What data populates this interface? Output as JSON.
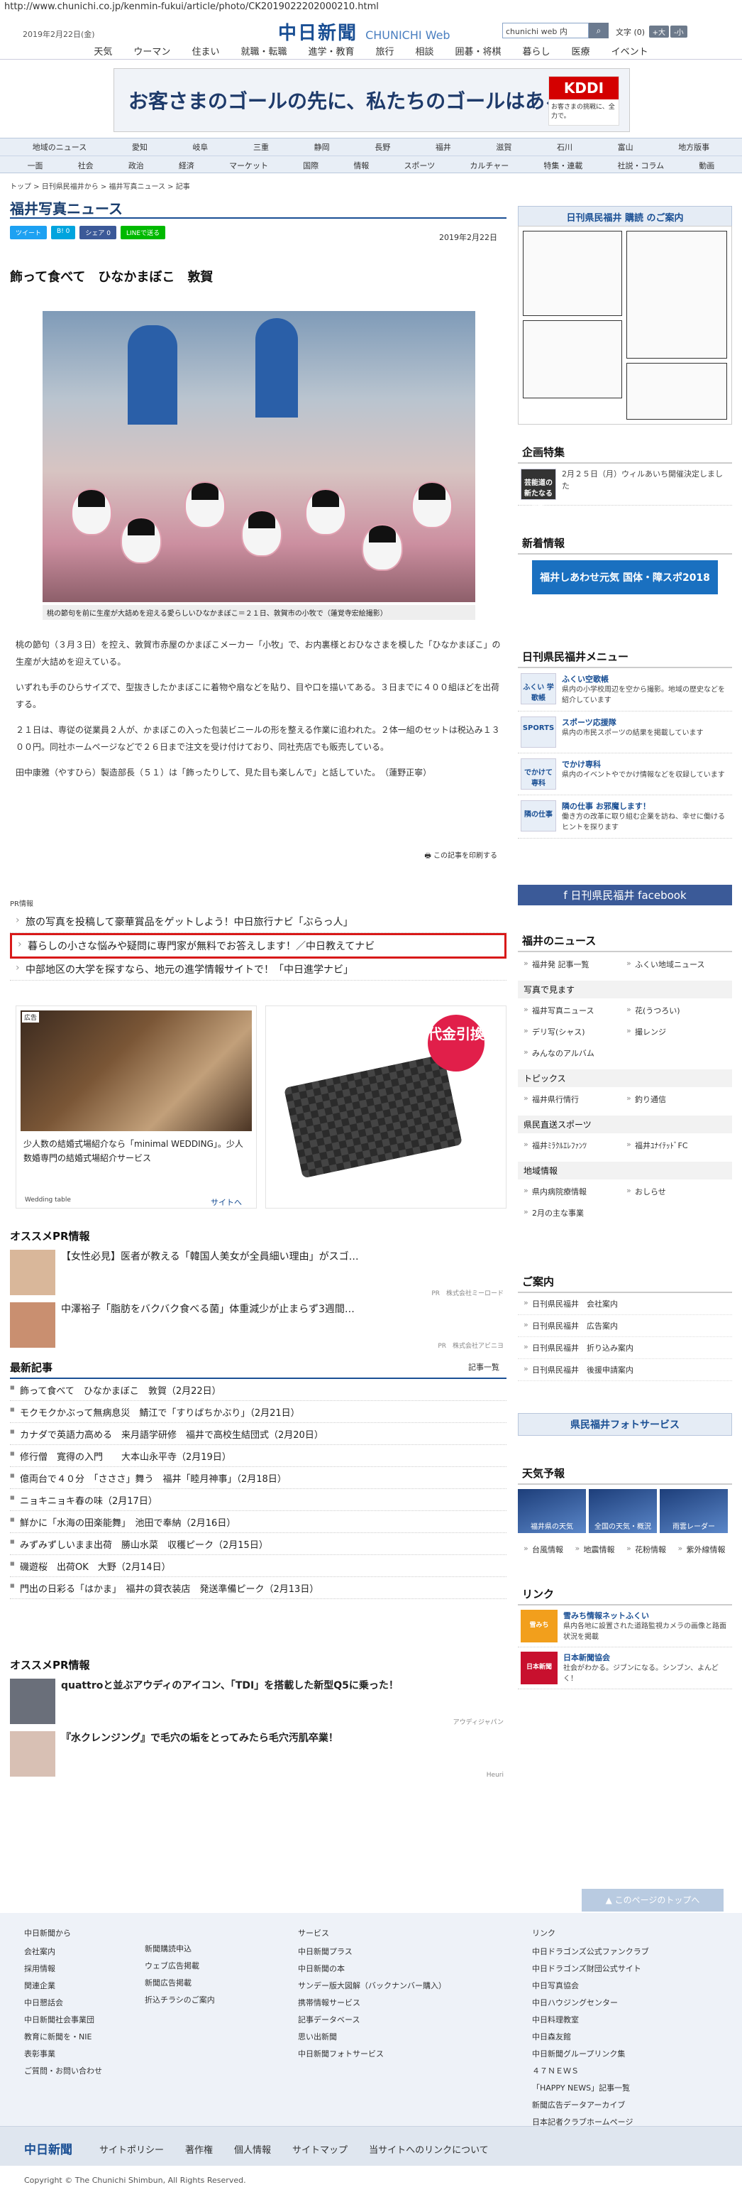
{
  "browser_url": "http://www.chunichi.co.jp/kenmin-fukui/article/photo/CK2019022202000210.html",
  "header": {
    "date": "2019年2月22日(金)",
    "logo_main": "中日新聞",
    "logo_sub": "CHUNICHI Web",
    "search_placeholder": "chunichi web 内",
    "search_icon": "search-icon",
    "fontsize_label": "文字 (0)",
    "fontsize_plus": "+大",
    "fontsize_minus": "-小"
  },
  "main_nav": [
    "天気",
    "ウーマン",
    "住まい",
    "就職・転職",
    "進学・教育",
    "旅行",
    "相談",
    "囲碁・将棋",
    "暮らし",
    "医療",
    "イベント"
  ],
  "ad_banner": {
    "text": "お客さまのゴールの先に、私たちのゴールはある。",
    "brand": "KDDI",
    "brand_sub": "お客さまの挑戦に、全力で。"
  },
  "sub_nav": {
    "row1": [
      "地域のニュース",
      "愛知",
      "岐阜",
      "三重",
      "静岡",
      "長野",
      "福井",
      "滋賀",
      "石川",
      "富山",
      "地方版事"
    ],
    "row2": [
      "一面",
      "社会",
      "政治",
      "経済",
      "マーケット",
      "国際",
      "情報",
      "スポーツ",
      "カルチャー",
      "特集・連載",
      "社説・コラム",
      "動画"
    ]
  },
  "breadcrumb": "トップ > 日刊県民福井から > 福井写真ニュース > 記事",
  "page_title": "福井写真ニュース",
  "social": {
    "tweet": "ツイート",
    "hatena": "B! 0",
    "share": "シェア 0",
    "line": "LINEで送る"
  },
  "article": {
    "date": "2019年2月22日",
    "headline": "飾って食べて　ひなかまぼこ　敦賀",
    "photo_caption": "桃の節句を前に生産が大詰めを迎える愛らしいひなかまぼこ＝２１日、敦賀市の小牧で（蓮覚寺宏絵撮影）",
    "paragraphs": [
      "桃の節句（３月３日）を控え、敦賀市赤屋のかまぼこメーカー「小牧」で、お内裏様とおひなさまを模した「ひなかまぼこ」の生産が大詰めを迎えている。",
      "いずれも手のひらサイズで、型抜きしたかまぼこに着物や扇などを貼り、目や口を描いてある。３日までに４００組ほどを出荷する。",
      "２１日は、専従の従業員２人が、かまぼこの入った包装ビニールの形を整える作業に追われた。２体一組のセットは税込み１３００円。同社ホームページなどで２６日まで注文を受け付けており、同社売店でも販売している。",
      "田中康雅（やすひら）製造部長（５１）は「飾ったりして、見た目も楽しんで」と話していた。　（蓮野正寧）"
    ],
    "print_label": "この記事を印刷する"
  },
  "pr": {
    "label": "PR情報",
    "items": [
      "旅の写真を投稿して豪華賞品をゲットしよう！中日旅行ナビ「ぶらっ人」",
      "暮らしの小さな悩みや疑問に専門家が無料でお答えします！／中日教えてナビ",
      "中部地区の大学を探すなら、地元の進学情報サイトで！「中日進学ナビ」"
    ]
  },
  "ad_wedding": {
    "tag": "広告",
    "text": "少人数の結婚式場紹介なら「minimal WEDDING」。少人数婚専門の結婚式場紹介サービス",
    "brand": "Wedding table",
    "site": "サイトへ"
  },
  "ad_wallet": {
    "badge": "代金引換"
  },
  "osusume1": {
    "title": "オススメPR情報",
    "items": [
      {
        "text": "【女性必見】医者が教える「韓国人美女が全員細い理由」がスゴ…",
        "src": "PR　株式会社ミーロード"
      },
      {
        "text": "中澤裕子「脂肪をバクバク食べる菌」体重減少が止まらず3週間…",
        "src": "PR　株式会社アビニヨ"
      }
    ]
  },
  "latest": {
    "title": "最新記事",
    "more": "記事一覧",
    "items": [
      "飾って食べて　ひなかまぼこ　敦賀（2月22日）",
      "モクモクかぶって無病息災　鯖江で「すりばちかぶり」（2月21日）",
      "カナダで英語力高める　来月語学研修　福井で高校生結団式（2月20日）",
      "修行僧　寛得の入門　　大本山永平寺（2月19日）",
      "億両台で４０分　「さささ」舞う　福井「睦月神事」（2月18日）",
      "ニョキニョキ春の味（2月17日）",
      "鮮かに「水海の田楽能舞」　池田で奉納（2月16日）",
      "みずみずしいまま出荷　勝山水菜　収穫ピーク（2月15日）",
      "磯遊桜　出荷OK　大野（2月14日）",
      "門出の日彩る「はかま」　福井の貸衣装店　発送準備ピーク（2月13日）"
    ]
  },
  "osusume2": {
    "title": "オススメPR情報",
    "items": [
      {
        "text": "quattroと並ぶアウディのアイコン、「TDI」を搭載した新型Q5に乗った！",
        "src": "アウディジャパン"
      },
      {
        "text": "『水クレンジング』で毛穴の垢をとってみたら毛穴汚肌卒業！",
        "src": "Heuri"
      }
    ]
  },
  "sidebar": {
    "subscribe": "日刊県民福井 購読 のご案内",
    "kikaku_title": "企画特集",
    "kikaku_item": "2月２５日（月）ウィルあいち開催決定しました",
    "kikaku_label": "芸能道の新たなる挑戦",
    "shinchaku_title": "新着情報",
    "shinchaku_banner": "福井しあわせ元気 国体・障スポ2018",
    "menu_title": "日刊県民福井メニュー",
    "menu": [
      {
        "icon": "ふくい 学歌帳",
        "title": "ふくい空歌帳",
        "desc": "県内の小学校周辺を空から撮影。地域の歴史などを紹介しています"
      },
      {
        "icon": "SPORTS",
        "title": "スポーツ応援隊",
        "desc": "県内の市民スポーツの結果を掲載しています"
      },
      {
        "icon": "でかけて専科",
        "title": "でかけ専科",
        "desc": "県内のイベントやでかけ情報などを収録しています"
      },
      {
        "icon": "隣の仕事",
        "title": "隣の仕事 お邪魔します！",
        "desc": "働き方の改革に取り組む企業を訪ね、幸せに働けるヒントを探ります"
      }
    ],
    "facebook": "日刊県民福井 facebook",
    "fukui_news_title": "福井のニュース",
    "fukui_news": [
      "福井発 記事一覧",
      "ふくい地域ニュース"
    ],
    "photo_hdr": "写真で見ます",
    "photo_links": [
      "福井写真ニュース",
      "花(うつろい)",
      "デリ写(シャス)",
      "撮レンジ",
      "みんなのアルバム"
    ],
    "topics_hdr": "トピックス",
    "topics": [
      "福井県行情行",
      "釣り通信"
    ],
    "sports_hdr": "県民直送スポーツ",
    "sports": [
      "福井ﾐﾗｸﾙｴﾚﾌｧﾝﾂ",
      "福井ﾕﾅｲﾃｯﾄﾞFC"
    ],
    "region_hdr": "地域情報",
    "region": [
      "県内病院療情報",
      "おしらせ",
      "2月の主な事業"
    ],
    "annai_title": "ご案内",
    "annai": [
      "日刊県民福井　会社案内",
      "日刊県民福井　広告案内",
      "日刊県民福井　折り込み案内",
      "日刊県民福井　後援申請案内"
    ],
    "photo_service": "県民福井フォトサービス",
    "tenki_title": "天気予報",
    "tenki": [
      "福井県の天気",
      "全国の天気・概況",
      "雨雲レーダー"
    ],
    "tenki_links": [
      "台風情報",
      "地震情報",
      "花粉情報",
      "紫外線情報"
    ],
    "link_title": "リンク",
    "links": [
      {
        "icon": "雪みち",
        "title": "雪みち情報ネットふくい",
        "desc": "県内各地に設置された道路監視カメラの画像と路面状況を掲載"
      },
      {
        "icon": "日本新聞",
        "title": "日本新聞協会",
        "desc": "社会がわかる。ジブンになる。シンブン、よんどく！"
      }
    ]
  },
  "pagetop": "このページのトップへ",
  "footer": {
    "col1_title": "中日新聞から",
    "col1": [
      "会社案内",
      "採用情報",
      "関連企業",
      "中日懇話会",
      "中日新聞社会事業団",
      "教育に新聞を・NIE",
      "表彰事業",
      "ご質問・お問い合わせ"
    ],
    "col2": [
      "新聞購読申込",
      "ウェブ広告掲載",
      "新聞広告掲載",
      "折込チラシのご案内"
    ],
    "col3_title": "サービス",
    "col3": [
      "中日新聞プラス",
      "中日新聞の本",
      "サンデー版大図解（バックナンバー購入）",
      "携帯情報サービス",
      "記事データベース",
      "思い出新聞",
      "中日新聞フォトサービス"
    ],
    "col4_title": "リンク",
    "col4": [
      "中日ドラゴンズ公式ファンクラブ",
      "中日ドラゴンズ財団公式サイト",
      "中日写真協会",
      "中日ハウジングセンター",
      "中日料理教室",
      "中日森友館",
      "中日新聞グループリンク集",
      "４７ＮＥＷＳ",
      "「HAPPY NEWS」記事一覧",
      "新聞広告データアーカイブ",
      "日本記者クラブホームページ"
    ]
  },
  "footnav": {
    "brand": "中日新聞",
    "items": [
      "サイトポリシー",
      "著作権",
      "個人情報",
      "サイトマップ",
      "当サイトへのリンクについて"
    ]
  },
  "copyright": "Copyright © The Chunichi Shimbun, All Rights Reserved."
}
